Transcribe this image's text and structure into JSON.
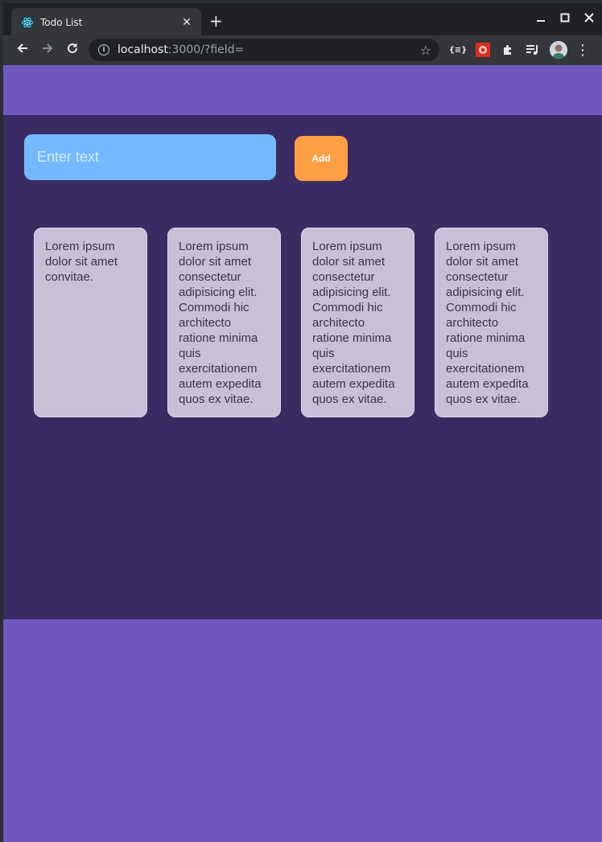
{
  "browser": {
    "tab": {
      "title": "Todo List",
      "favicon": "react-icon"
    },
    "url": {
      "host": "localhost",
      "path": ":3000/?field="
    }
  },
  "app": {
    "input": {
      "placeholder": "Enter text",
      "value": ""
    },
    "add_label": "Add",
    "todos": [
      {
        "text": "Lorem ipsum dolor sit amet convitae."
      },
      {
        "text": "Lorem ipsum dolor sit amet consectetur adipisicing elit. Commodi hic architecto ratione minima quis exercitationem autem expedita quos ex vitae."
      },
      {
        "text": "Lorem ipsum dolor sit amet consectetur adipisicing elit. Commodi hic architecto ratione minima quis exercitationem autem expedita quos ex vitae."
      },
      {
        "text": "Lorem ipsum dolor sit amet consectetur adipisicing elit. Commodi hic architecto ratione minima quis exercitationem autem expedita quos ex vitae."
      }
    ]
  },
  "colors": {
    "header": "#7157be",
    "main": "#3a2c63",
    "input": "#74b9ff",
    "button": "#ff9f43",
    "card": "#c7c0d6"
  }
}
